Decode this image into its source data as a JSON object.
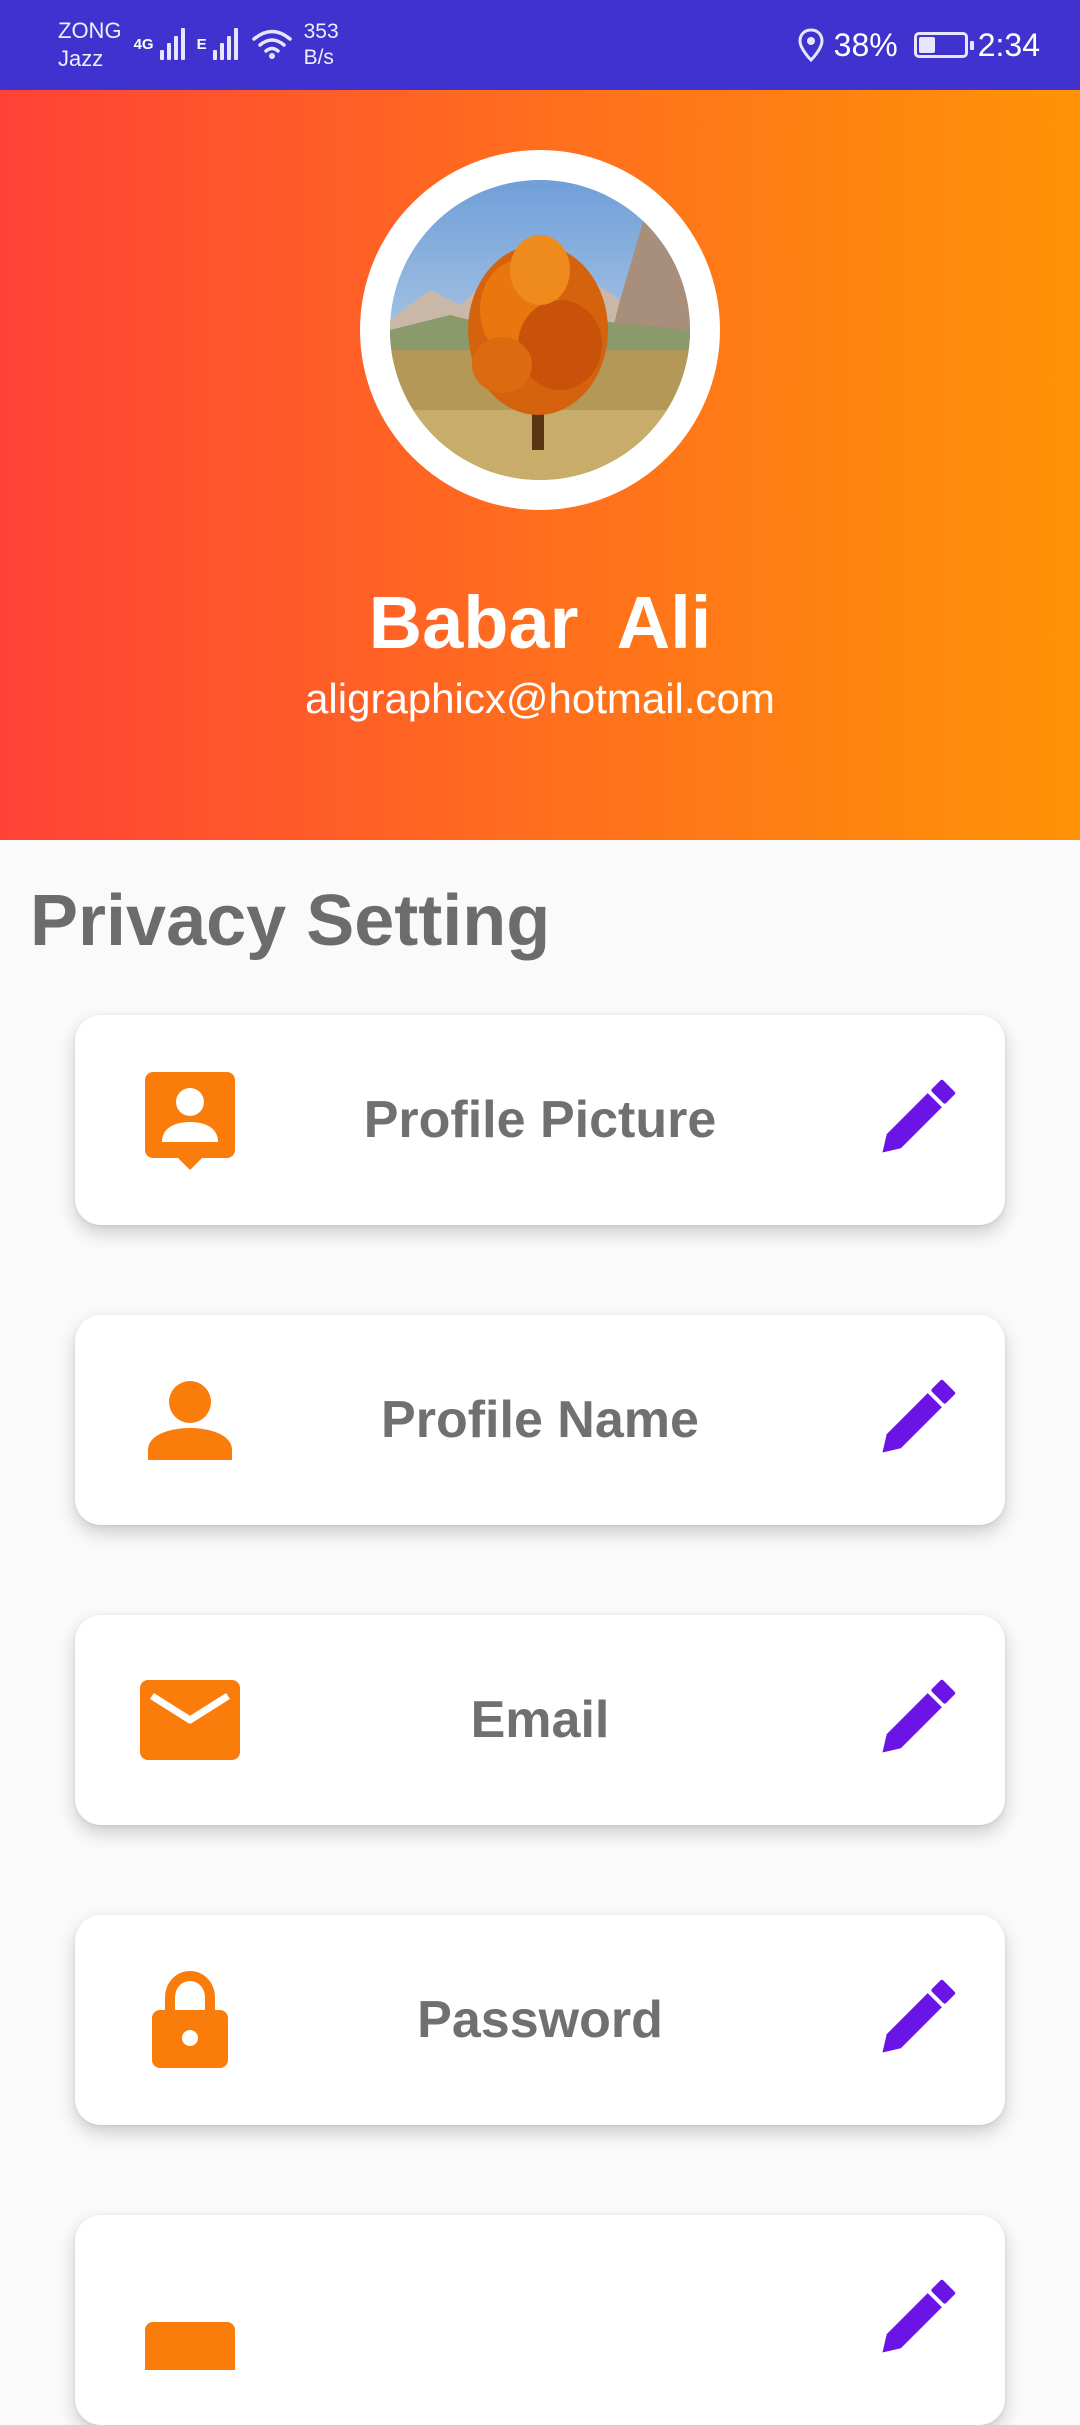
{
  "status_bar": {
    "carrier_1": "ZONG",
    "carrier_2": "Jazz",
    "net_type_1": "4G",
    "net_type_2": "E",
    "speed_value": "353",
    "speed_unit": "B/s",
    "battery": "38%",
    "battery_level": 0.38,
    "time": "2:34"
  },
  "header": {
    "name": "Babar  Ali",
    "email": "aligraphicx@hotmail.com"
  },
  "section": {
    "title": "Privacy Setting"
  },
  "settings": [
    {
      "label": "Profile Picture",
      "icon": "account-box-icon"
    },
    {
      "label": "Profile Name",
      "icon": "person-icon"
    },
    {
      "label": "Email",
      "icon": "mail-icon"
    },
    {
      "label": "Password",
      "icon": "lock-icon"
    },
    {
      "label": "",
      "icon": "more-setting-icon"
    }
  ],
  "colors": {
    "status_bar": "#3f32cf",
    "gradient_start": "#ff4236",
    "gradient_end": "#ff9306",
    "icon_orange": "#fa7c0a",
    "edit_purple": "#6a14e6",
    "label_gray": "#707070"
  }
}
